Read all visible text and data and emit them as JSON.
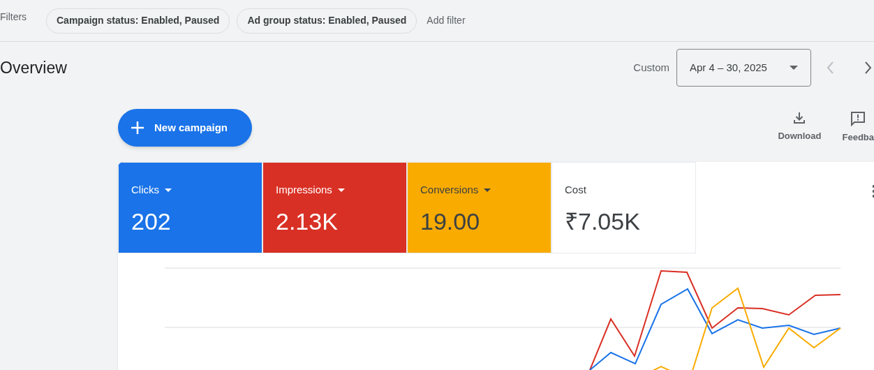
{
  "filters": {
    "label": "Filters",
    "chips": [
      "Campaign status: Enabled, Paused",
      "Ad group status: Enabled, Paused"
    ],
    "add_filter": "Add filter"
  },
  "overview": {
    "title": "Overview",
    "date_label": "Custom",
    "date_range": "Apr 4 – 30, 2025"
  },
  "toolbar": {
    "new_campaign": "New campaign",
    "actions": [
      {
        "kind": "download",
        "label": "Download"
      },
      {
        "kind": "feedback",
        "label": "Feedba"
      }
    ]
  },
  "metrics": [
    {
      "label": "Clicks",
      "value": "202",
      "color": "#1a73e8",
      "dropdown": true
    },
    {
      "label": "Impressions",
      "value": "2.13K",
      "color": "#d93025",
      "dropdown": true
    },
    {
      "label": "Conversions",
      "value": "19.00",
      "color": "#f9ab00",
      "dropdown": true
    },
    {
      "label": "Cost",
      "value": "₹7.05K",
      "color": "#ffffff",
      "dropdown": false
    }
  ]
}
